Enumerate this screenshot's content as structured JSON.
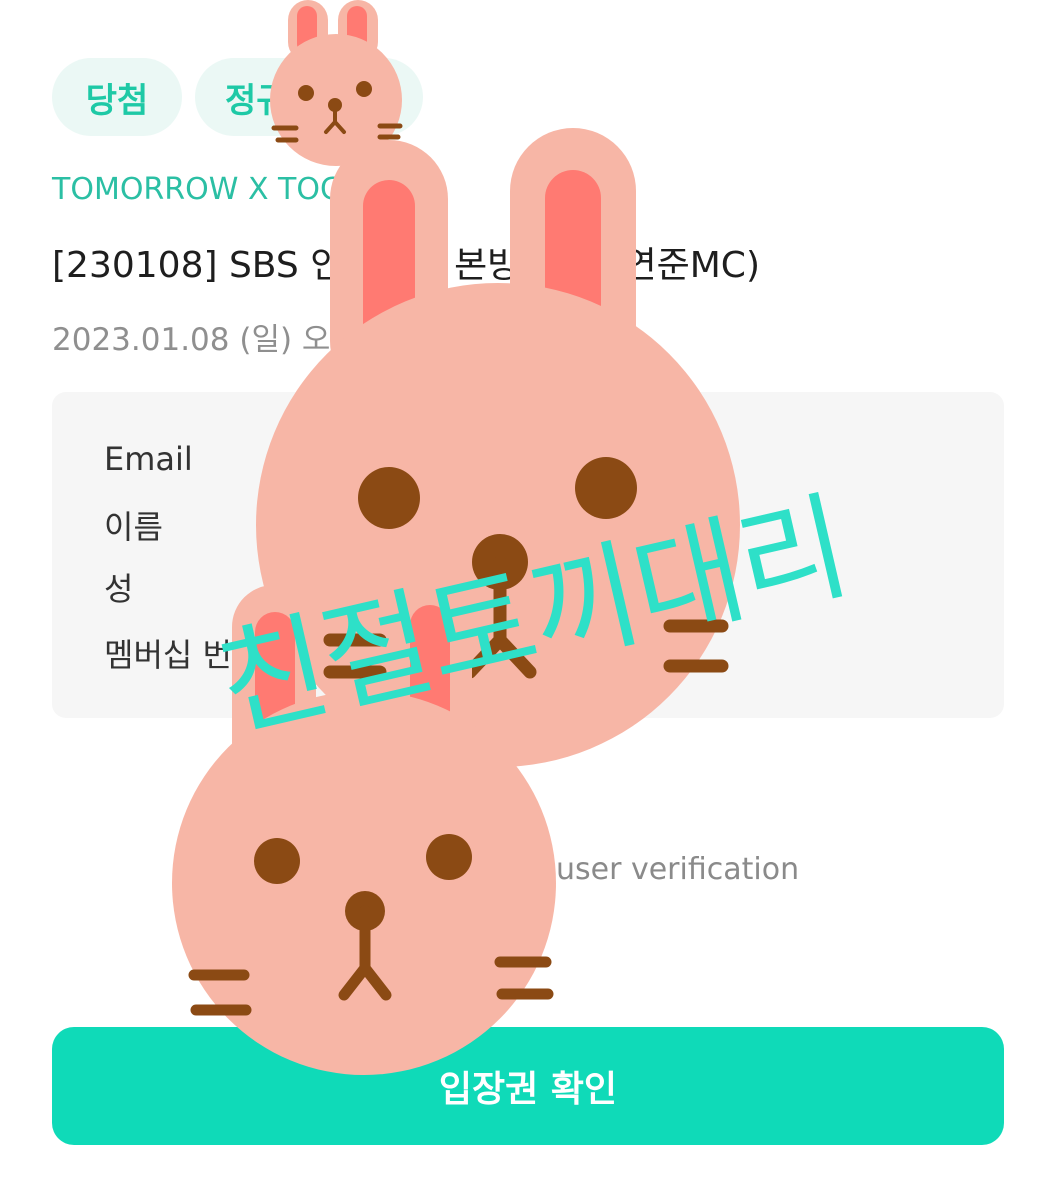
{
  "tags": [
    "당첨",
    "정규"
  ],
  "artist": "TOMORROW X TOG",
  "event_title": "[230108] SBS 인기가요 본방 참여 (연준MC)",
  "event_date": "2023.01.08 (일) 오후",
  "info_labels": {
    "email": "Email",
    "first_name": "이름",
    "last_name": "성",
    "membership": "멤버십 번"
  },
  "verification_hint": "user verification",
  "confirm_button": "입장권 확인",
  "watermark": {
    "text": "친절토끼대리",
    "color": "#2ee0c8"
  },
  "colors": {
    "accent": "#0fdab8",
    "chip_bg": "#ebf8f5",
    "bunny_face": "#f7b6a6",
    "bunny_ear_inner": "#ff7a72",
    "bunny_feature": "#8b4a14"
  }
}
